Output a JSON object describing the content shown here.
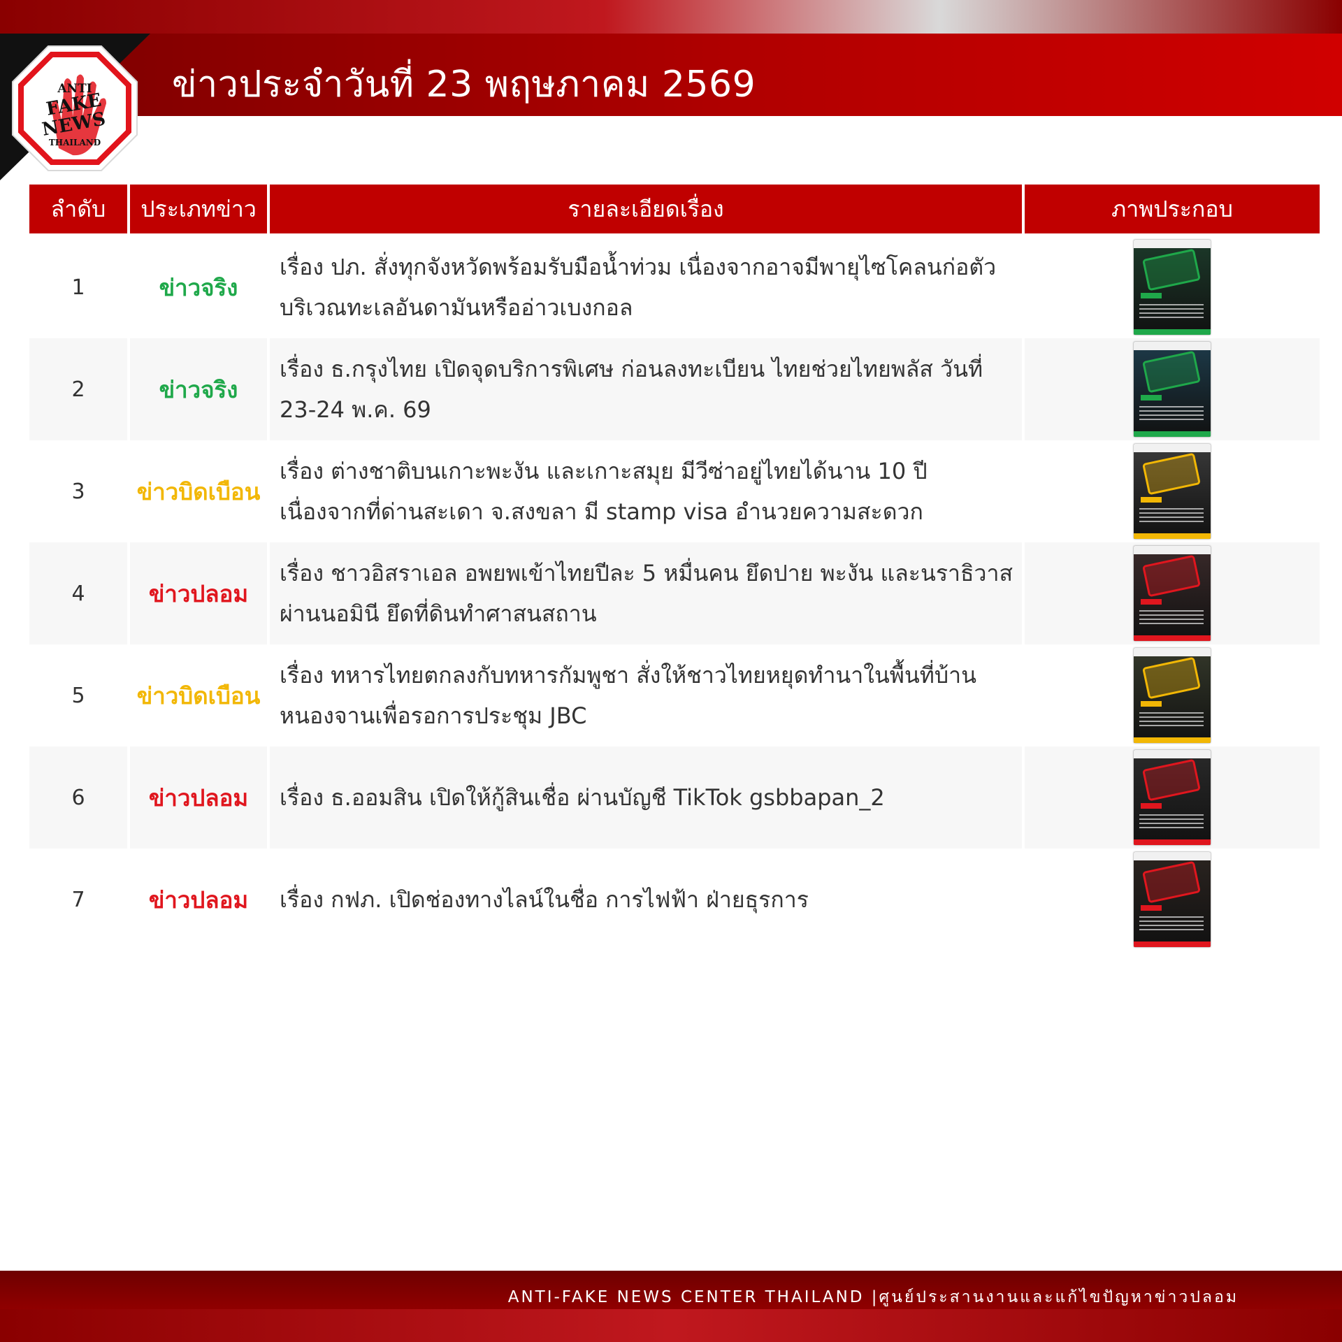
{
  "header": {
    "title": "ข่าวประจำวันที่ 23 พฤษภาคม 2569",
    "logo_text": [
      "ANTI",
      "FAKE",
      "NEWS",
      "THAILAND"
    ]
  },
  "table": {
    "columns": [
      "ลำดับ",
      "ประเภทข่าว",
      "รายละเอียดเรื่อง",
      "ภาพประกอบ"
    ],
    "rows": [
      {
        "index": "1",
        "type": "ข่าวจริง",
        "type_color": "#1fa84a",
        "detail": "เรื่อง ปภ. สั่งทุกจังหวัดพร้อมรับมือน้ำท่วม เนื่องจากอาจมีพายุไซโคลนก่อตัวบริเวณทะเลอันดามันหรืออ่าวเบงกอล"
      },
      {
        "index": "2",
        "type": "ข่าวจริง",
        "type_color": "#1fa84a",
        "detail": "เรื่อง ธ.กรุงไทย เปิดจุดบริการพิเศษ ก่อนลงทะเบียน ไทยช่วยไทยพลัส วันที่ 23-24 พ.ค. 69"
      },
      {
        "index": "3",
        "type": "ข่าวบิดเบือน",
        "type_color": "#f2b705",
        "detail": "เรื่อง ต่างชาติบนเกาะพะงัน และเกาะสมุย มีวีซ่าอยู่ไทยได้นาน 10 ปี เนื่องจากที่ด่านสะเดา จ.สงขลา มี stamp visa อำนวยความสะดวก"
      },
      {
        "index": "4",
        "type": "ข่าวปลอม",
        "type_color": "#e0161e",
        "detail": "เรื่อง ชาวอิสราเอล อพยพเข้าไทยปีละ 5 หมื่นคน ยึดปาย พะงัน และนราธิวาส ผ่านนอมินี ยึดที่ดินทำศาสนสถาน"
      },
      {
        "index": "5",
        "type": "ข่าวบิดเบือน",
        "type_color": "#f2b705",
        "detail": "เรื่อง ทหารไทยตกลงกับทหารกัมพูชา สั่งให้ชาวไทยหยุดทำนาในพื้นที่บ้านหนองจานเพื่อรอการประชุม JBC"
      },
      {
        "index": "6",
        "type": "ข่าวปลอม",
        "type_color": "#e0161e",
        "detail": "เรื่อง ธ.ออมสิน เปิดให้กู้สินเชื่อ ผ่านบัญชี TikTok gsbbapan_2"
      },
      {
        "index": "7",
        "type": "ข่าวปลอม",
        "type_color": "#e0161e",
        "detail": "เรื่อง กฟภ. เปิดช่องทางไลน์ในชื่อ การไฟฟ้า ฝ่ายธุรการ"
      }
    ]
  },
  "footer": {
    "text": "ANTI-FAKE NEWS CENTER THAILAND |ศูนย์ประสานงานและแก้ไขปัญหาข่าวปลอม"
  },
  "colors": {
    "brand_red": "#c00000",
    "true_news": "#1fa84a",
    "distorted_news": "#f2b705",
    "fake_news": "#e0161e"
  }
}
